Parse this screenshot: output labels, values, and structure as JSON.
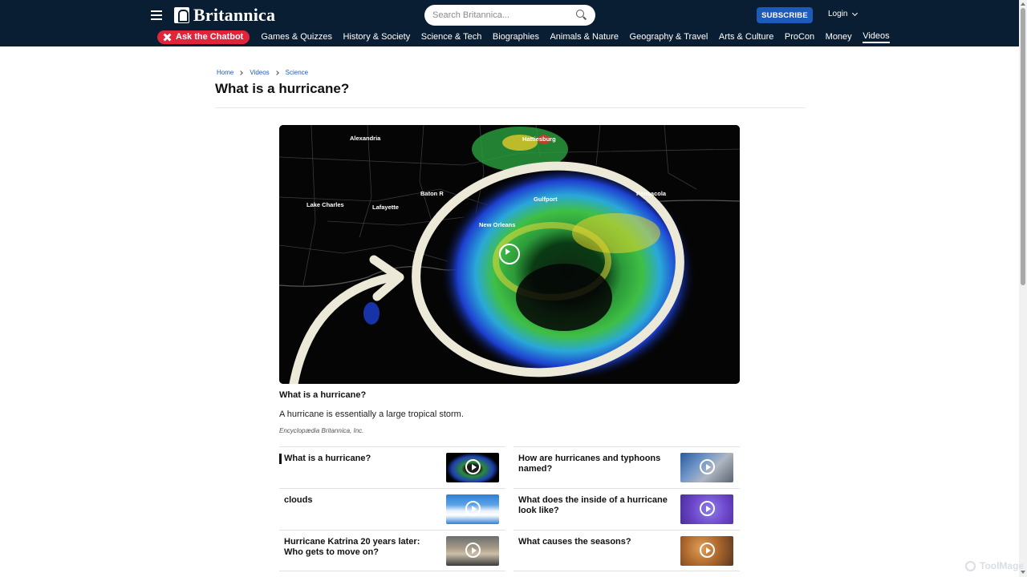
{
  "header": {
    "logo_text": "Britannica",
    "search_placeholder": "Search Britannica...",
    "subscribe_label": "SUBSCRIBE",
    "login_label": "Login",
    "chatbot_label": "Ask the Chatbot",
    "nav": [
      {
        "label": "Games & Quizzes"
      },
      {
        "label": "History & Society"
      },
      {
        "label": "Science & Tech"
      },
      {
        "label": "Biographies"
      },
      {
        "label": "Animals & Nature"
      },
      {
        "label": "Geography & Travel"
      },
      {
        "label": "Arts & Culture"
      },
      {
        "label": "ProCon"
      },
      {
        "label": "Money"
      },
      {
        "label": "Videos",
        "active": true
      }
    ]
  },
  "breadcrumb": [
    "Home",
    "Videos",
    "Science"
  ],
  "page_title": "What is a hurricane?",
  "video": {
    "map_labels": [
      "Alexandria",
      "Hattiesburg",
      "Baton R",
      "Gulfport",
      "Pensacola",
      "Lake Charles",
      "Lafayette",
      "New Orleans"
    ]
  },
  "caption": {
    "title": "What is a hurricane?",
    "description": "A hurricane is essentially a large tropical storm.",
    "credit": "Encyclopædia Britannica, Inc."
  },
  "related": [
    {
      "title": "What is a hurricane?",
      "thumb": "hurricane-radar",
      "current": true
    },
    {
      "title": "How are hurricanes and typhoons named?",
      "thumb": "name-tag"
    },
    {
      "title": "clouds",
      "thumb": "clouds"
    },
    {
      "title": "What does the inside of a hurricane look like?",
      "thumb": "purple-storm"
    },
    {
      "title": "Hurricane Katrina 20 years later: Who gets to move on?",
      "thumb": "katrina-house"
    },
    {
      "title": "What causes the seasons?",
      "thumb": "autumn-tree"
    }
  ],
  "watermark": "ToolMage",
  "colors": {
    "header_bg": "#0a1e33",
    "subscribe_bg": "#1d5bb8",
    "chatbot_bg": "#e0243a",
    "link": "#1d5bb8"
  }
}
